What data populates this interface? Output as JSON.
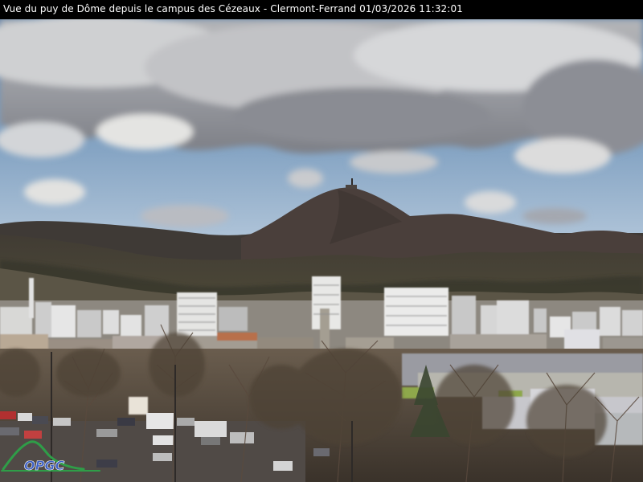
{
  "caption": "Vue du puy de Dôme depuis le campus des Cézeaux - Clermont-Ferrand 01/03/2026 11:32:01",
  "logo_text": "OPGC",
  "colors": {
    "sky_top": "#5f82a8",
    "sky_horizon": "#b9cbdd",
    "cloud": "#e6e6e4",
    "cloud_shadow": "#7d7f86",
    "mountain": "#4a3f3b",
    "hills": "#3b3a2c",
    "city": "#cfcfcf",
    "trees": "#4b3f34",
    "logo_green": "#2f9d48",
    "logo_blue": "#3c5fc4"
  }
}
